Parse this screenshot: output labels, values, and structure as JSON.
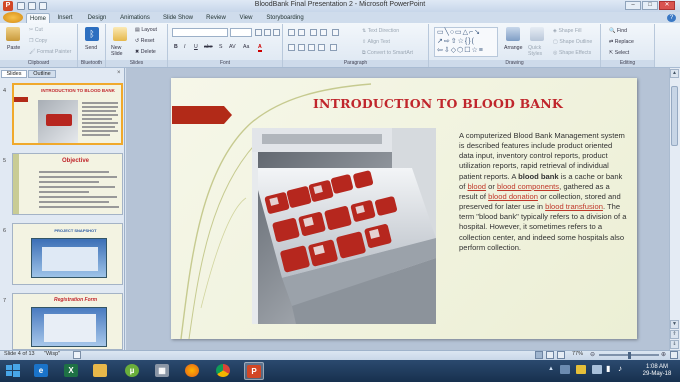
{
  "window": {
    "title": "BloodBank Final Presentation 2 - Microsoft PowerPoint",
    "app_icon_letter": "P",
    "minimize": "–",
    "maximize": "□",
    "close": "✕"
  },
  "ribbon_tabs": [
    "Home",
    "Insert",
    "Design",
    "Animations",
    "Slide Show",
    "Review",
    "View",
    "Storyboarding"
  ],
  "ribbon": {
    "clipboard": {
      "paste": "Paste",
      "cut": "Cut",
      "copy": "Copy",
      "format_painter": "Format Painter",
      "label": "Clipboard"
    },
    "bluetooth": {
      "send": "Send",
      "label": "Bluetooth"
    },
    "slides": {
      "new_slide": "New Slide",
      "layout": "Layout",
      "reset": "Reset",
      "delete": "Delete",
      "label": "Slides"
    },
    "font": {
      "bold": "B",
      "italic": "I",
      "underline": "U",
      "strike": "abe",
      "shadow": "S",
      "spacing": "AV",
      "case": "Aa",
      "color": "A",
      "label": "Font"
    },
    "paragraph": {
      "text_direction": "Text Direction",
      "align_text": "Align Text",
      "smartart": "Convert to SmartArt",
      "label": "Paragraph"
    },
    "drawing": {
      "arrange": "Arrange",
      "quick_styles": "Quick Styles",
      "shape_fill": "Shape Fill",
      "shape_outline": "Shape Outline",
      "shape_effects": "Shape Effects",
      "label": "Drawing"
    },
    "editing": {
      "find": "Find",
      "replace": "Replace",
      "select": "Select",
      "label": "Editing"
    }
  },
  "pane": {
    "slides_tab": "Slides",
    "outline_tab": "Outline",
    "close": "×",
    "thumbs": [
      {
        "num": "4",
        "title": "INTRODUCTION TO BLOOD BANK"
      },
      {
        "num": "5",
        "title": "Objective"
      },
      {
        "num": "6",
        "title": "PROJECT SNAPSHOT"
      },
      {
        "num": "7",
        "title": "Registration Form"
      }
    ]
  },
  "slide": {
    "title": "INTRODUCTION TO BLOOD BANK",
    "body": {
      "p1": "A computerized Blood Bank Management system is described features include product oriented data input, inventory control reports, product utilization reports, rapid retrieval of individual patient reports. A ",
      "bold1": "blood bank",
      "p2": " is a cache or bank of ",
      "link1": "blood",
      "p3": " or ",
      "link2": "blood components",
      "p4": ", gathered as a result of ",
      "link3": "blood donation",
      "p5": " or collection, stored and preserved for later use in ",
      "link4": "blood transfusion",
      "p6": ". The term \"blood bank\" typically refers to a division of a hospital. However, it sometimes refers to a collection center, and indeed some hospitals also perform collection."
    }
  },
  "statusbar": {
    "slide_info": "Slide 4 of 13",
    "theme": "\"Wisp\"",
    "zoom": "77%"
  },
  "taskbar": {
    "clock_time": "1:08 AM",
    "clock_date": "29-May-18"
  },
  "colors": {
    "title_red": "#c0262c",
    "link_red": "#c0392b",
    "arrow_red": "#b22a18"
  }
}
